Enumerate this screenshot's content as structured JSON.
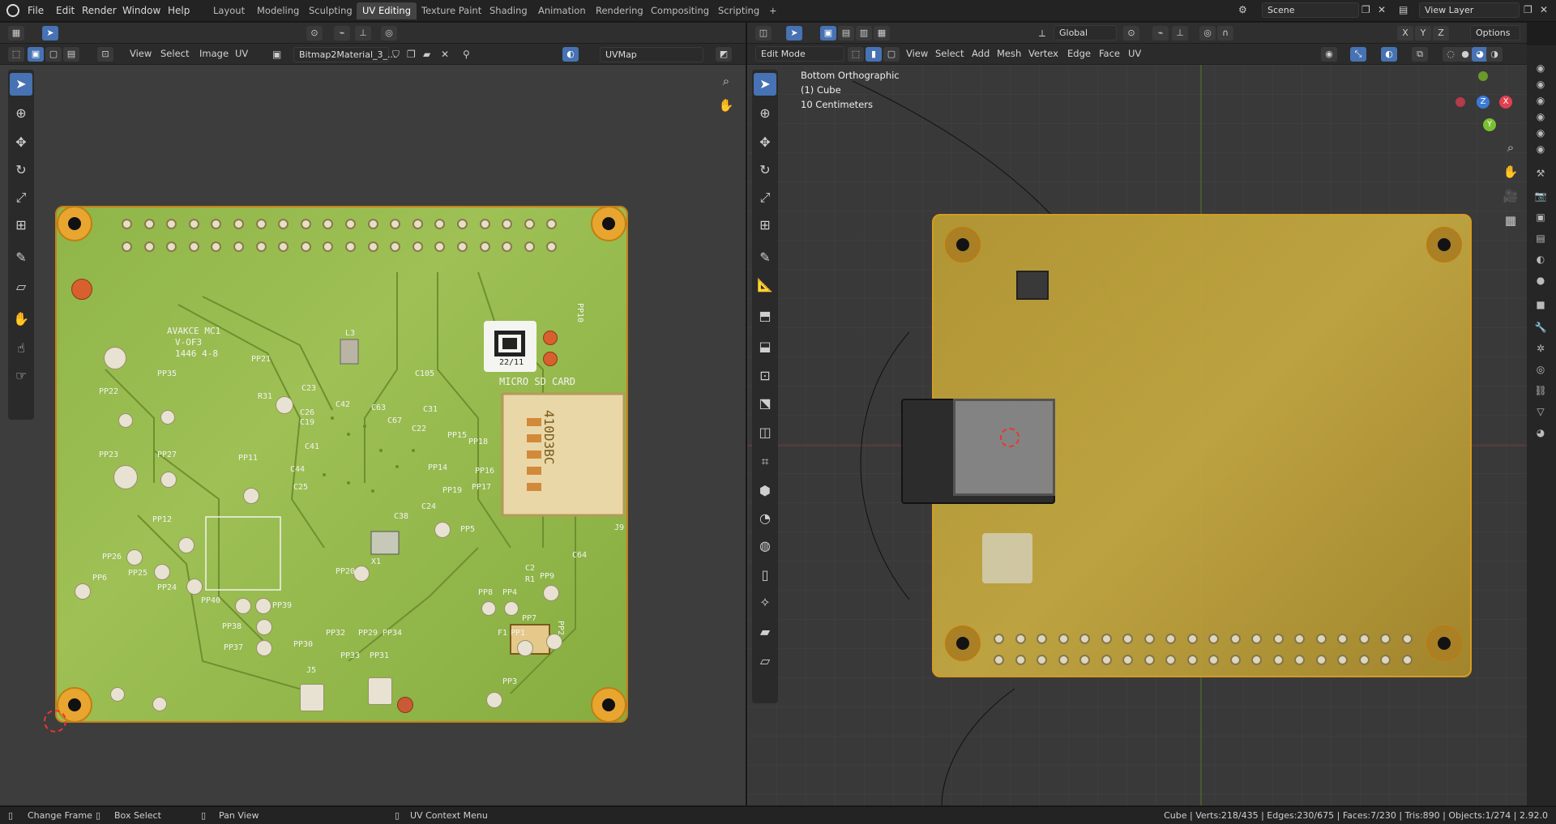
{
  "topbar": {
    "menus": [
      "File",
      "Edit",
      "Render",
      "Window",
      "Help"
    ],
    "workspaces": [
      "Layout",
      "Modeling",
      "Sculpting",
      "UV Editing",
      "Texture Paint",
      "Shading",
      "Animation",
      "Rendering",
      "Compositing",
      "Scripting"
    ],
    "active_workspace": "UV Editing",
    "add_tab": "+",
    "scene": "Scene",
    "view_layer": "View Layer"
  },
  "uv_editor": {
    "header": {
      "view": "View",
      "select": "Select",
      "image": "Image",
      "uv": "UV",
      "image_name": "Bitmap2Material_3_...",
      "uvmap": "UVMap"
    },
    "pcb": {
      "brand": "AVAKCE MC1",
      "version": "V-OF3",
      "date": "1446  4-8",
      "sd_label": "MICRO SD CARD",
      "sd_text": "410D3BC",
      "qr_date": "22/11",
      "labels": [
        "PP35",
        "PP22",
        "PP23",
        "PP27",
        "PP21",
        "R31",
        "PP11",
        "PP12",
        "PP26",
        "PP25",
        "PP24",
        "PP6",
        "PP40",
        "PP39",
        "PP38",
        "PP37",
        "PP20",
        "PP30",
        "PP32",
        "PP33",
        "PP29",
        "PP31",
        "PP34",
        "PP14",
        "PP15",
        "PP18",
        "PP16",
        "PP17",
        "PP19",
        "PP5",
        "PP8",
        "PP4",
        "PP9",
        "PP7",
        "PP1",
        "PP2",
        "PP3",
        "PP10",
        "J5",
        "J9",
        "F1",
        "X1",
        "L3",
        "C23",
        "C26",
        "C19",
        "C41",
        "C44",
        "C25",
        "C105",
        "C31",
        "C22",
        "C24",
        "C38",
        "C64",
        "C2",
        "R1",
        "C42",
        "C67",
        "C63"
      ]
    }
  },
  "viewport": {
    "header": {
      "mode": "Edit Mode",
      "view": "View",
      "select": "Select",
      "add": "Add",
      "mesh": "Mesh",
      "vertex": "Vertex",
      "edge": "Edge",
      "face": "Face",
      "uv": "UV",
      "orientation": "Global",
      "options": "Options"
    },
    "overlay": {
      "view_name": "Bottom Orthographic",
      "object": "(1) Cube",
      "scale": "10 Centimeters"
    },
    "gizmo": {
      "x": "X",
      "y": "Y",
      "z": "Z"
    }
  },
  "statusbar": {
    "left1": "Change Frame",
    "left2": "Box Select",
    "left3": "Pan View",
    "left4": "UV Context Menu",
    "right": "Cube | Verts:218/435 | Edges:230/675 | Faces:7/230 | Tris:890 | Objects:1/274 | 2.92.0"
  },
  "colors": {
    "accent": "#4772b3",
    "pcb_green": "#93b84a",
    "pcb_orange": "#c6a93a",
    "hole_gold": "#e8a530"
  }
}
